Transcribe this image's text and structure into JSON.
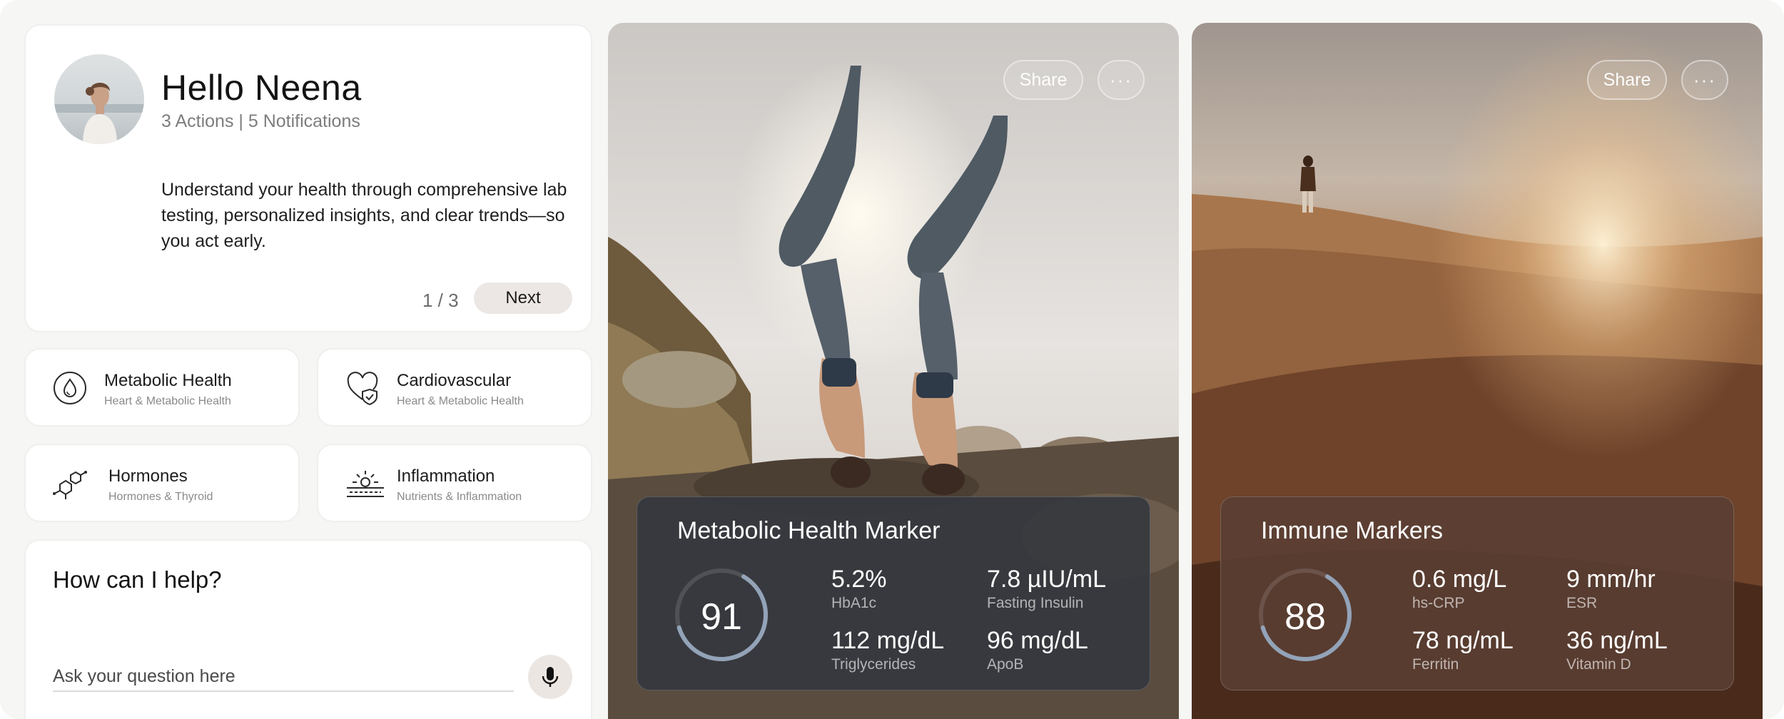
{
  "greeting": {
    "title": "Hello Neena",
    "subtitle": "3 Actions | 5 Notifications",
    "intro": "Understand your health through comprehensive lab testing, personalized insights, and clear trends—so you act early.",
    "pager": "1 / 3",
    "next_label": "Next"
  },
  "categories": [
    {
      "name": "Metabolic Health",
      "sub": "Heart & Metabolic Health",
      "icon": "droplet-icon"
    },
    {
      "name": "Cardiovascular",
      "sub": "Heart & Metabolic Health",
      "icon": "heart-shield-icon"
    },
    {
      "name": "Hormones",
      "sub": "Hormones & Thyroid",
      "icon": "molecule-icon"
    },
    {
      "name": "Inflammation",
      "sub": "Nutrients & Inflammation",
      "icon": "sun-waves-icon"
    }
  ],
  "help": {
    "title": "How can I help?",
    "placeholder": "Ask your question here"
  },
  "cards": [
    {
      "share_label": "Share",
      "more_label": "···",
      "title": "Metabolic Health Marker",
      "score": "91",
      "score_fraction": 0.62,
      "metrics": [
        {
          "value": "5.2%",
          "label": "HbA1c"
        },
        {
          "value": "7.8 µIU/mL",
          "label": "Fasting Insulin"
        },
        {
          "value": "112 mg/dL",
          "label": "Triglycerides"
        },
        {
          "value": "96 mg/dL",
          "label": "ApoB"
        }
      ]
    },
    {
      "share_label": "Share",
      "more_label": "···",
      "title": "Immune Markers",
      "score": "88",
      "score_fraction": 0.62,
      "metrics": [
        {
          "value": "0.6 mg/L",
          "label": "hs-CRP"
        },
        {
          "value": "9 mm/hr",
          "label": "ESR"
        },
        {
          "value": "78 ng/mL",
          "label": "Ferritin"
        },
        {
          "value": "36 ng/mL",
          "label": "Vitamin D"
        }
      ]
    }
  ],
  "colors": {
    "page_bg": "#f6f6f5",
    "card_bg": "#ffffff",
    "next_button": "#ece7e4",
    "gauge_arc": "#93a3b8",
    "panel_cool": "#3a3d44",
    "panel_warm": "#5a3f33"
  }
}
